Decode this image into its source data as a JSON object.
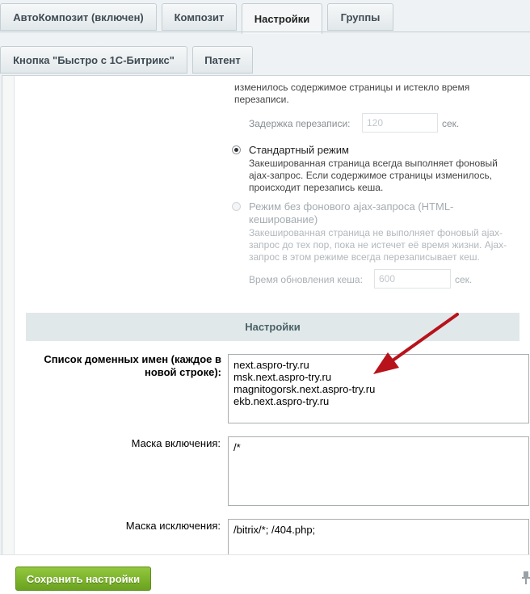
{
  "tabs_row1": [
    "АвтоКомпозит (включен)",
    "Композит",
    "Настройки",
    "Группы"
  ],
  "tabs_row2": [
    "Кнопка \"Быстро с 1С-Битрикс\"",
    "Патент"
  ],
  "active_tab": "Настройки",
  "top_desc_lines": [
    "изменилось содержимое страницы и истекло время",
    "перезаписи."
  ],
  "delay": {
    "label": "Задержка перезаписи:",
    "value": "120",
    "unit": "сек."
  },
  "standard_mode": {
    "label": "Стандартный режим",
    "desc": [
      "Закешированная страница всегда выполняет фоновый",
      "ajax-запрос. Если содержимое страницы изменилось,",
      "происходит перезапись кеша."
    ]
  },
  "html_mode": {
    "label": [
      "Режим без фонового ajax-запроса (HTML-",
      "кеширование)"
    ],
    "desc": [
      "Закешированная страница не выполняет фоновый ajax-",
      "запрос до тех пор, пока не истечет её время жизни. Ajax-",
      "запрос в этом режиме всегда перезаписывает кеш."
    ]
  },
  "cache_refresh": {
    "label": "Время обновления кеша:",
    "value": "600",
    "unit": "сек."
  },
  "section_title": "Настройки",
  "domains": {
    "label": [
      "Список доменных имен (каждое в",
      "новой строке):"
    ],
    "value": "next.aspro-try.ru\nmsk.next.aspro-try.ru\nmagnitogorsk.next.aspro-try.ru\nekb.next.aspro-try.ru"
  },
  "include_mask": {
    "label": "Маска включения:",
    "value": "/*"
  },
  "exclude_mask": {
    "label": "Маска исключения:",
    "value": "/bitrix/*; /404.php;"
  },
  "save_button": "Сохранить настройки",
  "colors": {
    "save_green": "#7ab32e",
    "arrow_red": "#b8121b"
  }
}
